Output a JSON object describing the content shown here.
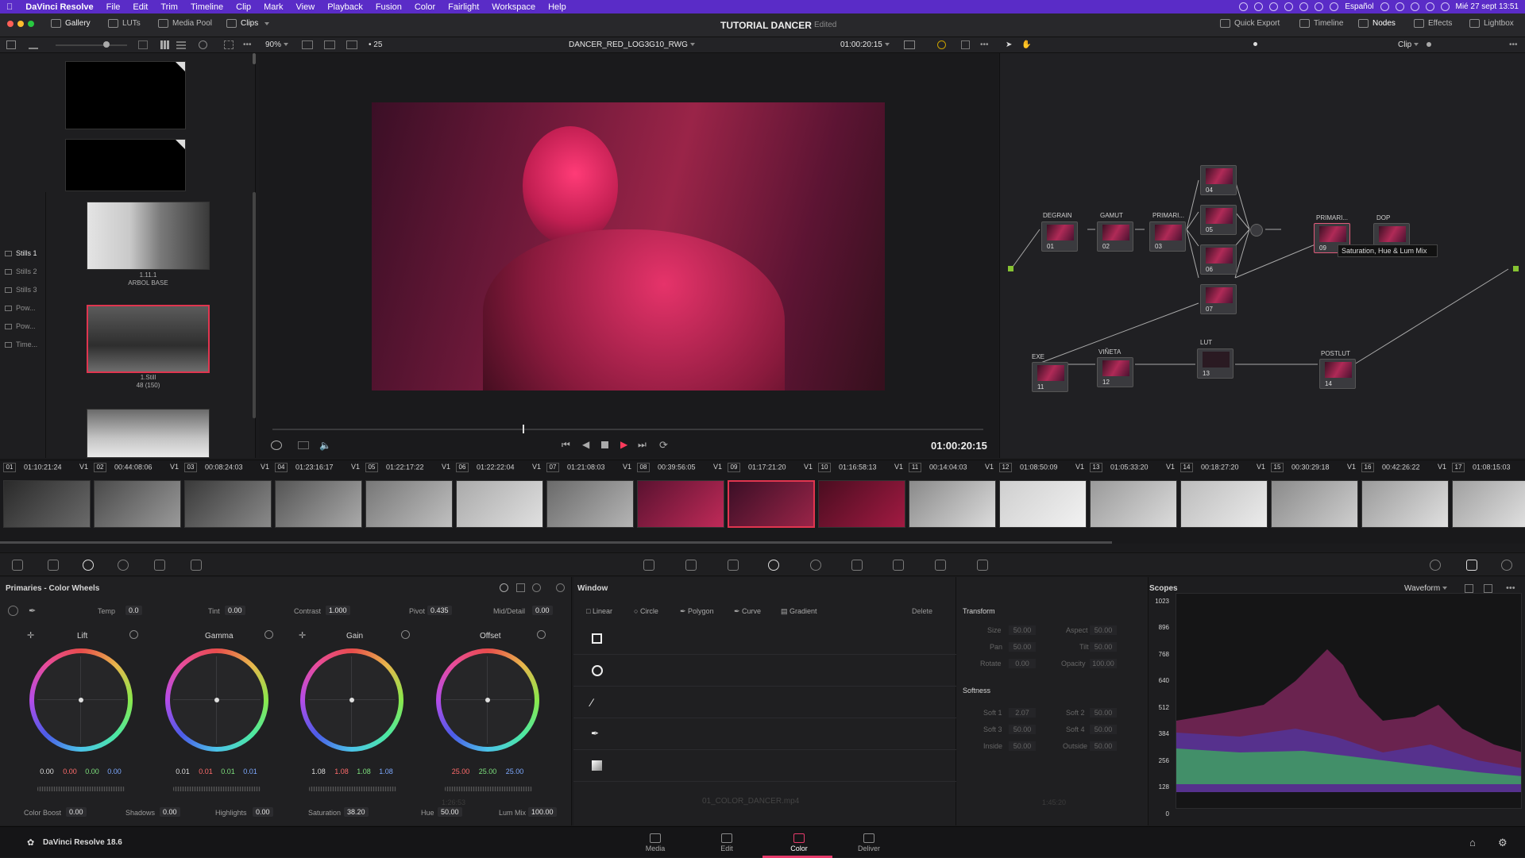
{
  "menubar": {
    "app": "DaVinci Resolve",
    "items": [
      "File",
      "Edit",
      "Trim",
      "Timeline",
      "Clip",
      "Mark",
      "View",
      "Playback",
      "Fusion",
      "Color",
      "Fairlight",
      "Workspace",
      "Help"
    ],
    "language": "Español",
    "clock": "Mié 27 sept  13:51"
  },
  "toolbar": {
    "gallery": "Gallery",
    "luts": "LUTs",
    "media_pool": "Media Pool",
    "clips": "Clips",
    "project": "TUTORIAL DANCER",
    "status": "Edited",
    "quick_export": "Quick Export",
    "timeline": "Timeline",
    "nodes": "Nodes",
    "effects": "Effects",
    "lightbox": "Lightbox"
  },
  "viewer_bar": {
    "zoom": "90%",
    "count": "25",
    "clip_name": "DANCER_RED_LOG3G10_RWG",
    "timecode": "01:00:20:15",
    "clip_mode": "Clip"
  },
  "albums": [
    "Stills 1",
    "Stills 2",
    "Stills 3",
    "Pow...",
    "Pow...",
    "Time..."
  ],
  "stills": [
    {
      "label1": "1.11.1",
      "label2": "ARBOL BASE"
    },
    {
      "label1": "1.Still",
      "label2": "48 (150)"
    }
  ],
  "viewer": {
    "timecode": "01:00:20:15"
  },
  "nodes": {
    "labels": [
      "DEGRAIN",
      "GAMUT",
      "PRIMARI...",
      "PRIMARI...",
      "DOP",
      "EXE",
      "VIÑETA",
      "LUT",
      "POSTLUT"
    ],
    "numbers": [
      "01",
      "02",
      "03",
      "04",
      "05",
      "06",
      "07",
      "09",
      "11",
      "12",
      "13",
      "14"
    ],
    "tooltip": "Saturation, Hue & Lum Mix"
  },
  "clips": [
    {
      "n": "01",
      "tc": "01:10:21:24",
      "tr": "V1"
    },
    {
      "n": "02",
      "tc": "00:44:08:06",
      "tr": "V1"
    },
    {
      "n": "03",
      "tc": "00:08:24:03",
      "tr": "V1"
    },
    {
      "n": "04",
      "tc": "01:23:16:17",
      "tr": "V1"
    },
    {
      "n": "05",
      "tc": "01:22:17:22",
      "tr": "V1"
    },
    {
      "n": "06",
      "tc": "01:22:22:04",
      "tr": "V1"
    },
    {
      "n": "07",
      "tc": "01:21:08:03",
      "tr": "V1"
    },
    {
      "n": "08",
      "tc": "00:39:56:05",
      "tr": "V1"
    },
    {
      "n": "09",
      "tc": "01:17:21:20",
      "tr": "V1"
    },
    {
      "n": "10",
      "tc": "01:16:58:13",
      "tr": "V1"
    },
    {
      "n": "11",
      "tc": "00:14:04:03",
      "tr": "V1"
    },
    {
      "n": "12",
      "tc": "01:08:50:09",
      "tr": "V1"
    },
    {
      "n": "13",
      "tc": "01:05:33:20",
      "tr": "V1"
    },
    {
      "n": "14",
      "tc": "00:18:27:20",
      "tr": "V1"
    },
    {
      "n": "15",
      "tc": "00:30:29:18",
      "tr": "V1"
    },
    {
      "n": "16",
      "tc": "00:42:26:22",
      "tr": "V1"
    },
    {
      "n": "17",
      "tc": "01:08:15:03",
      "tr": ""
    }
  ],
  "primaries": {
    "title": "Primaries - Color Wheels",
    "temp_label": "Temp",
    "temp": "0.0",
    "tint_label": "Tint",
    "tint": "0.00",
    "contrast_label": "Contrast",
    "contrast": "1.000",
    "pivot_label": "Pivot",
    "pivot": "0.435",
    "md_label": "Mid/Detail",
    "md": "0.00",
    "wheels": [
      {
        "name": "Lift",
        "vals": [
          "0.00",
          "0.00",
          "0.00",
          "0.00"
        ]
      },
      {
        "name": "Gamma",
        "vals": [
          "0.01",
          "0.01",
          "0.01",
          "0.01"
        ]
      },
      {
        "name": "Gain",
        "vals": [
          "1.08",
          "1.08",
          "1.08",
          "1.08"
        ]
      },
      {
        "name": "Offset",
        "vals": [
          "25.00",
          "25.00",
          "25.00"
        ]
      }
    ],
    "boost_label": "Color Boost",
    "boost": "0.00",
    "shadows_label": "Shadows",
    "shadows": "0.00",
    "highlights_label": "Highlights",
    "highlights": "0.00",
    "sat_label": "Saturation",
    "sat": "38.20",
    "hue_label": "Hue",
    "hue": "50.00",
    "lum_label": "Lum Mix",
    "lum": "100.00"
  },
  "window": {
    "title": "Window",
    "tools": [
      "Linear",
      "Circle",
      "Polygon",
      "Curve",
      "Gradient"
    ],
    "delete": "Delete",
    "transform": "Transform",
    "size_l": "Size",
    "size": "50.00",
    "aspect_l": "Aspect",
    "aspect": "50.00",
    "pan_l": "Pan",
    "pan": "50.00",
    "tilt_l": "Tilt",
    "tilt": "50.00",
    "rotate_l": "Rotate",
    "rotate": "0.00",
    "opacity_l": "Opacity",
    "opacity": "100.00",
    "softness": "Softness",
    "s1_l": "Soft 1",
    "s1": "2.07",
    "s2_l": "Soft 2",
    "s2": "50.00",
    "s3_l": "Soft 3",
    "s3": "50.00",
    "s4_l": "Soft 4",
    "s4": "50.00",
    "in_l": "Inside",
    "in": "50.00",
    "out_l": "Outside",
    "out": "50.00",
    "filename": "01_COLOR_DANCER.mp4",
    "tc_left": "1:26:53",
    "tc_right": "1:45:20"
  },
  "scopes": {
    "title": "Scopes",
    "mode": "Waveform",
    "ticks": [
      "1023",
      "896",
      "768",
      "640",
      "512",
      "384",
      "256",
      "128",
      "0"
    ]
  },
  "bottom": {
    "version": "DaVinci Resolve 18.6",
    "pages": [
      "Media",
      "Edit",
      "Color",
      "Deliver"
    ]
  }
}
